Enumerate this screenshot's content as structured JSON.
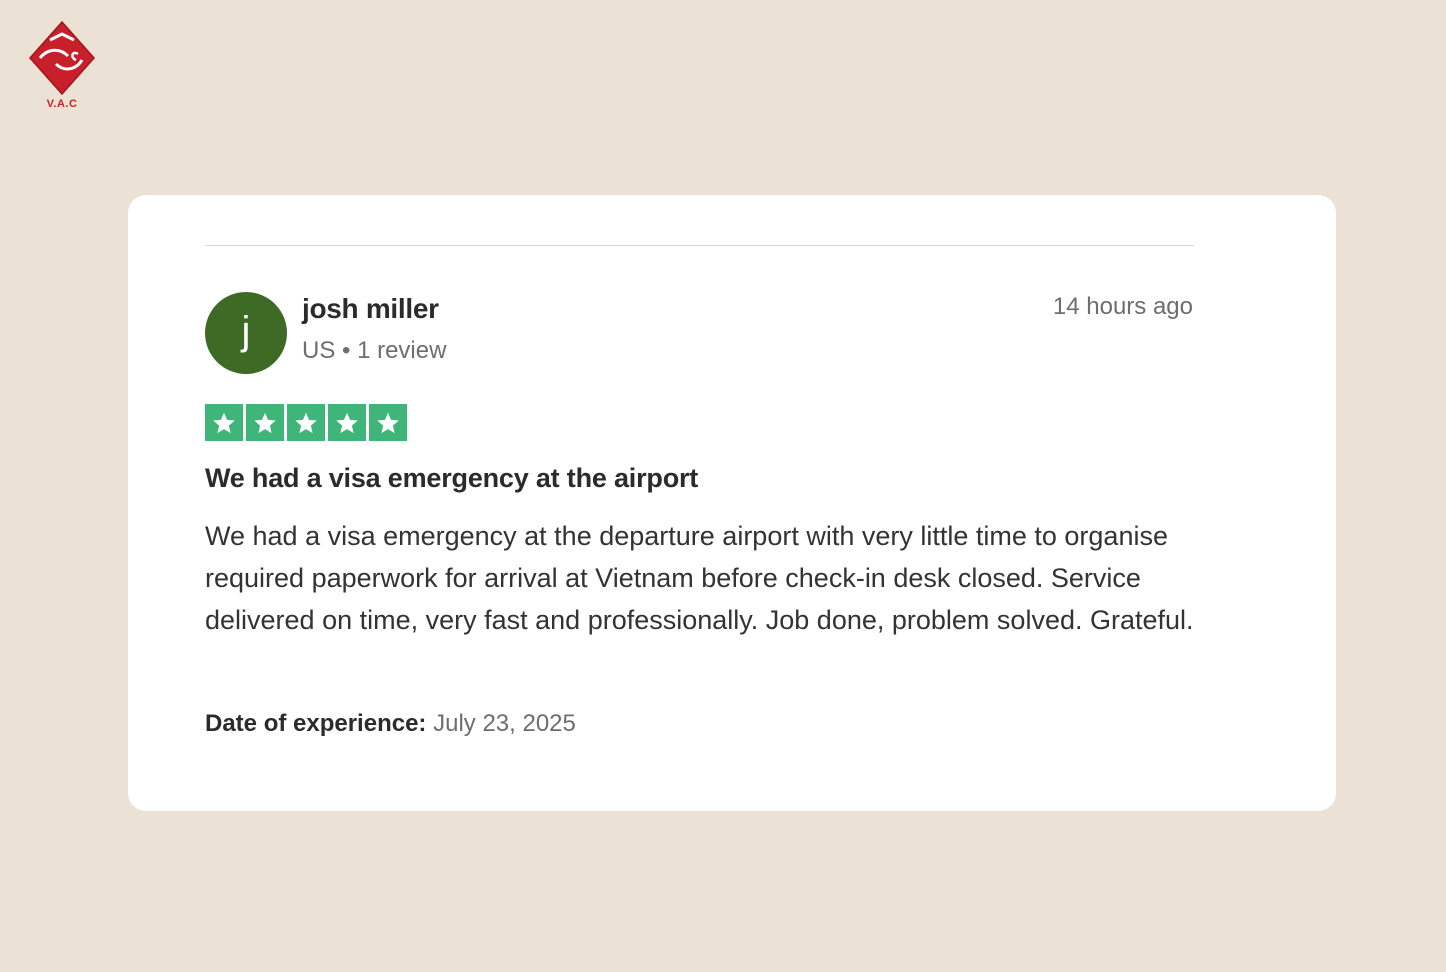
{
  "logo": {
    "text": "V.A.C",
    "icon": "vac-logo-icon",
    "color": "#c8202a"
  },
  "review": {
    "reviewer": {
      "initial": "j",
      "name": "josh miller",
      "meta": "US • 1 review",
      "avatar_color": "#3d6a25"
    },
    "timestamp": "14 hours ago",
    "rating": {
      "stars": 5,
      "max": 5,
      "color": "#3fb57a",
      "icon": "star-icon"
    },
    "title": "We had a visa emergency at the airport",
    "body": "We had a visa emergency at the departure airport with very little time to organise required paperwork for arrival at Vietnam before check-in desk closed. Service delivered on time, very fast and professionally. Job done, problem solved. Grateful.",
    "experience_label": "Date of experience:",
    "experience_date": "July 23, 2025"
  },
  "colors": {
    "background": "#ebe1d5",
    "card": "#ffffff"
  }
}
